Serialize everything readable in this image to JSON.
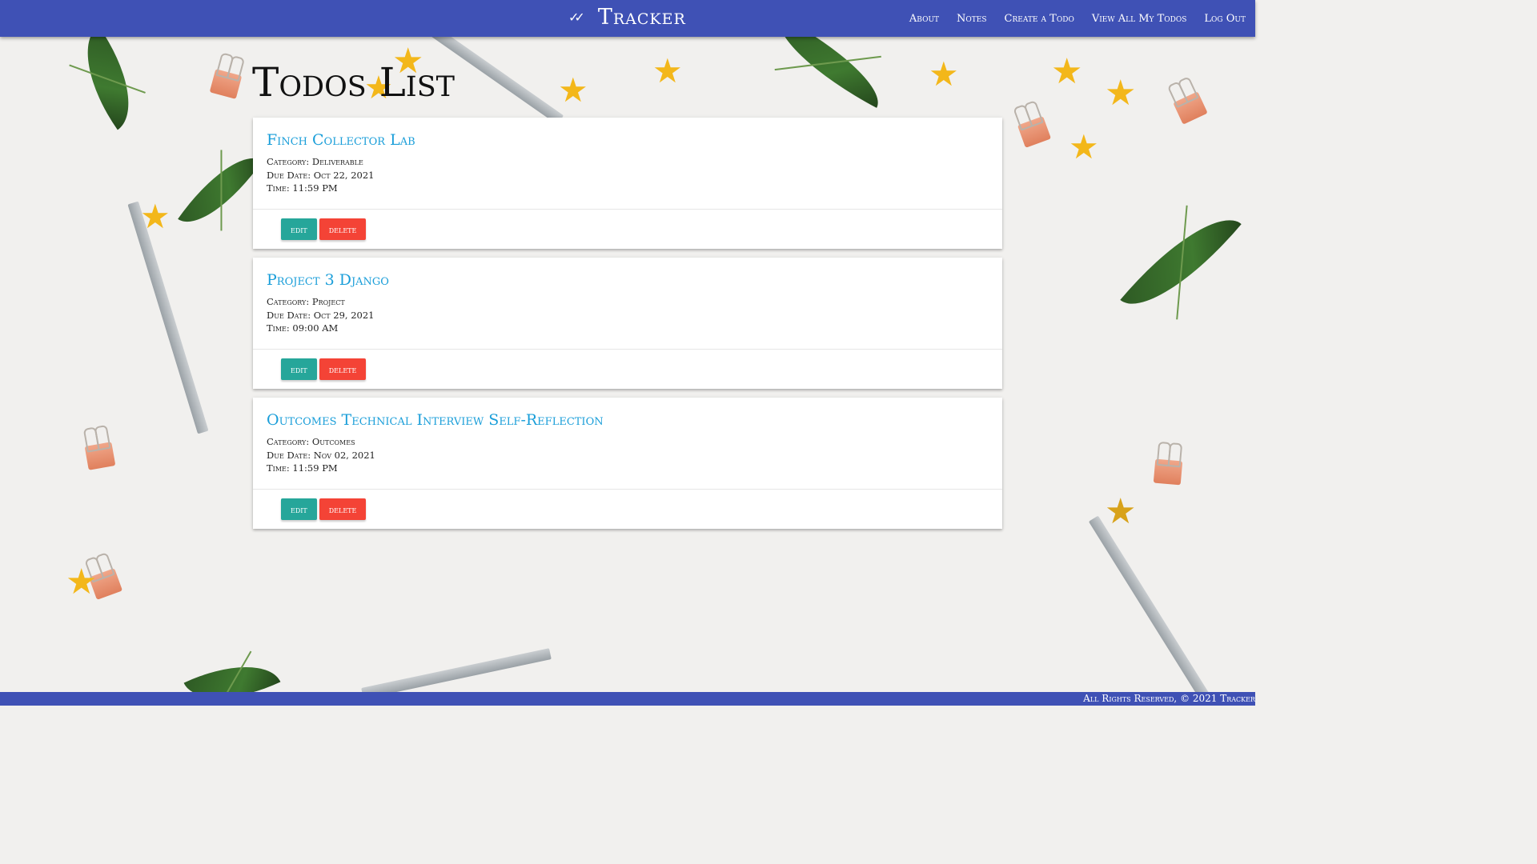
{
  "brand": {
    "icon": "double-check-icon",
    "name": "Tracker"
  },
  "nav": [
    "About",
    "Notes",
    "Create a Todo",
    "View All My Todos",
    "Log Out"
  ],
  "page_title": "Todos List",
  "todos": [
    {
      "title": "Finch Collector Lab",
      "category": "Category: Deliverable",
      "due": "Due Date: Oct 22, 2021",
      "time": "Time: 11:59 PM"
    },
    {
      "title": "Project 3 Django",
      "category": "Category: Project",
      "due": "Due Date: Oct 29, 2021",
      "time": "Time: 09:00 AM"
    },
    {
      "title": "Outcomes Technical Interview Self-Reflection",
      "category": "Category: Outcomes",
      "due": "Due Date: Nov 02, 2021",
      "time": "Time: 11:59 PM"
    }
  ],
  "buttons": {
    "edit": "EDIT",
    "delete": "DELETE"
  },
  "footer": "All Rights Reserved, © 2021 Tracker",
  "colors": {
    "navbar": "#3f51b5",
    "edit": "#26a69a",
    "delete": "#f44336",
    "title": "#1a9ed9"
  }
}
